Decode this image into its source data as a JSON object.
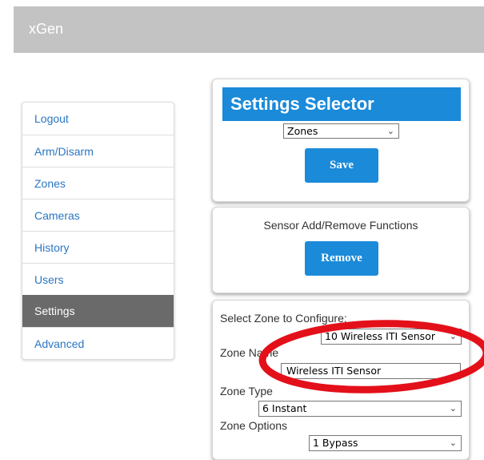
{
  "header": {
    "brand": "xGen"
  },
  "sidebar": {
    "items": [
      {
        "label": "Logout"
      },
      {
        "label": "Arm/Disarm"
      },
      {
        "label": "Zones"
      },
      {
        "label": "Cameras"
      },
      {
        "label": "History"
      },
      {
        "label": "Users"
      },
      {
        "label": "Settings",
        "active": true
      },
      {
        "label": "Advanced"
      }
    ]
  },
  "settings_selector": {
    "title": "Settings Selector",
    "selected": "Zones",
    "save_label": "Save"
  },
  "sensor_functions": {
    "title": "Sensor Add/Remove Functions",
    "remove_label": "Remove"
  },
  "zone_config": {
    "select_label": "Select Zone to Configure:",
    "selected_zone": "10 Wireless ITI Sensor",
    "zone_name_label": "Zone Name",
    "zone_name_value": "Wireless ITI Sensor",
    "zone_type_label": "Zone Type",
    "zone_type_value": "6 Instant",
    "zone_options_label": "Zone Options",
    "zone_options_value": "1 Bypass"
  },
  "colors": {
    "accent": "#1a8ad9",
    "sidebar_active": "#6a6a6a",
    "link": "#2a76c2",
    "header_bar": "#c3c3c3",
    "annotation": "#e3101a"
  },
  "icons": {
    "dropdown": "chevron-down-icon"
  }
}
